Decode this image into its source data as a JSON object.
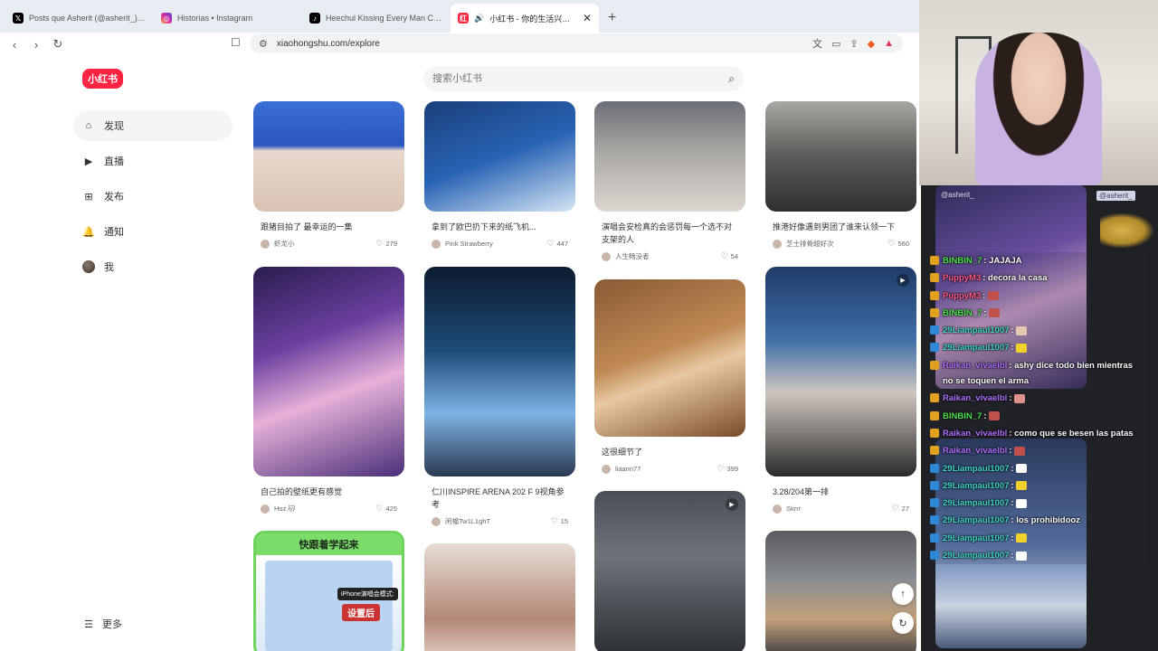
{
  "browser": {
    "tabs": [
      {
        "title": "Posts que Asherit (@asherit_) ha indicado",
        "icon": "x-logo-icon",
        "color": "#000000",
        "active": false
      },
      {
        "title": "Historias • Instagram",
        "icon": "instagram-icon",
        "color": "#d6249f",
        "active": false
      },
      {
        "title": "Heechul Kissing Every Man Compilation",
        "icon": "tiktok-icon",
        "color": "#000000",
        "active": false
      },
      {
        "title": "小红书 - 你的生活兴趣社区",
        "icon": "xiaohongshu-icon",
        "color": "#ff2442",
        "active": true
      }
    ],
    "url": "xiaohongshu.com/explore"
  },
  "site": {
    "logo": "小红书",
    "search_placeholder": "搜索小红书",
    "nav": [
      {
        "label": "发现",
        "icon": "home-icon",
        "active": true
      },
      {
        "label": "直播",
        "icon": "live-icon",
        "active": false
      },
      {
        "label": "发布",
        "icon": "plus-square-icon",
        "active": false
      },
      {
        "label": "通知",
        "icon": "bell-icon",
        "active": false
      },
      {
        "label": "我",
        "icon": "avatar",
        "active": false
      }
    ],
    "more": "更多"
  },
  "feed": [
    {
      "title": "跟猪目拍了 最幸运的一集",
      "author": "虾龙小",
      "likes": "279"
    },
    {
      "title": "拿到了欧巴扔下来的纸飞机...",
      "author": "Pink Strawberry",
      "likes": "447"
    },
    {
      "title": "演唱会安检真的会惩罚每一个选不对支架的人",
      "author": "人生畅没者",
      "likes": "54"
    },
    {
      "title": "推港好像遇到男团了谁来认领一下",
      "author": "芝士排骨超好次",
      "likes": "560"
    },
    {
      "title": "自己拍的壁纸更有感觉",
      "author": "Hoz.🐱",
      "likes": "425"
    },
    {
      "title": "仁川INSPIRE ARENA 202 F 9视角参考",
      "author": "闲幅Tw1L1ghT",
      "likes": "15"
    },
    {
      "title": "这很细节了",
      "author": "liaann77",
      "likes": "399"
    },
    {
      "title": "3.28/204第一排",
      "author": "Skrrr",
      "likes": "27"
    },
    {
      "poster_title": "快跟着学起来",
      "poster_tag1": "iPhone演唱会模式:",
      "poster_tag2": "设置后"
    }
  ],
  "chat": {
    "header_left": "@asherit_",
    "header_right": "@asherit_",
    "messages": [
      {
        "user": "BINBIN_7",
        "color": "#4ee34e",
        "badge": "gold",
        "text": "JAJAJA"
      },
      {
        "user": "PuppyM3",
        "color": "#ff5c8a",
        "badge": "gold",
        "text": "decora la casa"
      },
      {
        "user": "PuppyM3",
        "color": "#ff5c8a",
        "badge": "gold",
        "text": "",
        "emote": "#c0504a"
      },
      {
        "user": "BINBIN_7",
        "color": "#4ee34e",
        "badge": "gold",
        "text": "",
        "emote": "#c0504a"
      },
      {
        "user": "29Liampaul1007",
        "color": "#40d8c8",
        "badge": "blue",
        "text": "",
        "emote": "#e6c8b0"
      },
      {
        "user": "29Liampaul1007",
        "color": "#40d8c8",
        "badge": "blue",
        "text": "",
        "emote": "#f2d22a"
      },
      {
        "user": "Raikan_vivaelbl",
        "color": "#b070ff",
        "badge": "gold",
        "text": "ashy dice todo bien mientras no se toquen el arma"
      },
      {
        "user": "Raikan_vivaelbl",
        "color": "#b070ff",
        "badge": "gold",
        "text": "",
        "emote": "#e0908a"
      },
      {
        "user": "BINBIN_7",
        "color": "#4ee34e",
        "badge": "gold",
        "text": "",
        "emote": "#c0504a"
      },
      {
        "user": "Raikan_vivaelbl",
        "color": "#b070ff",
        "badge": "gold",
        "text": "como que se besen las patas"
      },
      {
        "user": "Raikan_vivaelbl",
        "color": "#b070ff",
        "badge": "gold",
        "text": "",
        "emote": "#c0504a"
      },
      {
        "user": "29Liampaul1007",
        "color": "#40d8c8",
        "badge": "blue",
        "text": "",
        "emote": "#ffffff"
      },
      {
        "user": "29Liampaul1007",
        "color": "#40d8c8",
        "badge": "blue",
        "text": "",
        "emote": "#f2d22a"
      },
      {
        "user": "29Liampaul1007",
        "color": "#40d8c8",
        "badge": "blue",
        "text": "",
        "emote": "#ffffff"
      },
      {
        "user": "29Liampaul1007",
        "color": "#40d8c8",
        "badge": "blue",
        "text": "los prohibidooz"
      },
      {
        "user": "29Liampaul1007",
        "color": "#40d8c8",
        "badge": "blue",
        "text": "",
        "emote": "#f2d22a"
      },
      {
        "user": "29Liampaul1007",
        "color": "#40d8c8",
        "badge": "blue",
        "text": "",
        "emote": "#ffffff"
      }
    ]
  }
}
